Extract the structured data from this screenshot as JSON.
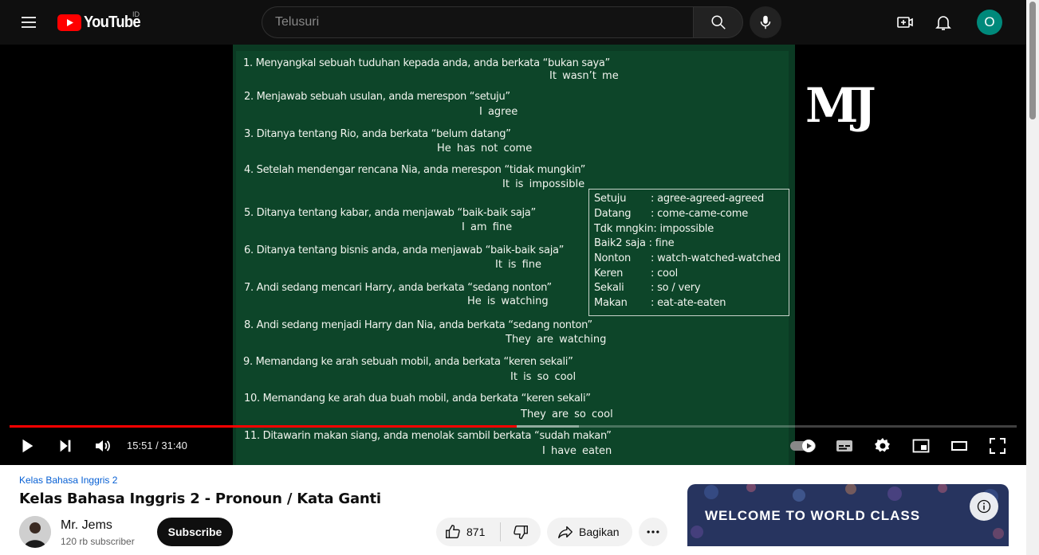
{
  "header": {
    "logo_text": "YouTube",
    "country_code": "ID",
    "search_placeholder": "Telusuri",
    "avatar_letter": "O"
  },
  "video": {
    "board_lines": [
      "1. Menyangkal sebuah tuduhan kepada anda, anda berkata “bukan saya”",
      "2. Menjawab sebuah usulan, anda merespon “setuju”",
      "3. Ditanya tentang Rio, anda berkata  “belum datang”",
      "4. Setelah mendengar rencana Nia, anda merespon “tidak mungkin”",
      "5. Ditanya tentang kabar, anda menjawab “baik-baik saja”",
      "6. Ditanya tentang bisnis anda, anda menjawab “baik-baik saja”",
      "7. Andi sedang mencari Harry, anda berkata “sedang nonton”",
      "8. Andi sedang menjadi Harry dan Nia, anda berkata “sedang nonton”",
      "9. Memandang ke arah sebuah mobil, anda berkata “keren sekali”",
      "10. Memandang ke arah dua buah mobil, anda berkata “keren sekali”",
      "11. Ditawarin makan siang, anda menolak sambil berkata “sudah makan”"
    ],
    "board_answers": [
      "It wasn’t me",
      "I agree",
      "He has not come",
      "It is impossible",
      "I am fine",
      "It is fine",
      "He is watching",
      "They are watching",
      "It is so cool",
      "They are so cool",
      "I have eaten"
    ],
    "vocab": [
      {
        "key": "Setuju",
        "val": ": agree-agreed-agreed"
      },
      {
        "key": "Datang",
        "val": ": come-came-come"
      },
      {
        "key": "Tdk mngkin",
        "val": ": impossible"
      },
      {
        "key": "Baik2 saja",
        "val": " : fine"
      },
      {
        "key": "Nonton",
        "val": ": watch-watched-watched"
      },
      {
        "key": "Keren",
        "val": ": cool"
      },
      {
        "key": "Sekali",
        "val": ": so / very"
      },
      {
        "key": "Makan",
        "val": ": eat-ate-eaten"
      }
    ],
    "watermark": "MJ",
    "time_display": "15:51 / 31:40",
    "progress_fraction": 0.5034,
    "buffer_fraction": 0.565
  },
  "info": {
    "hashtag": "Kelas Bahasa Inggris 2",
    "title": "Kelas Bahasa Inggris 2 - Pronoun / Kata Ganti",
    "channel_name": "Mr. Jems",
    "subscribers": "120 rb subscriber",
    "subscribe_label": "Subscribe",
    "like_count": "871",
    "share_label": "Bagikan"
  },
  "ad": {
    "text": "WELCOME TO WORLD CLASS"
  },
  "colors": {
    "brand_red": "#ff0000",
    "avatar_teal": "#00897b",
    "board_green": "#0d4529",
    "link_blue": "#065fd4"
  }
}
